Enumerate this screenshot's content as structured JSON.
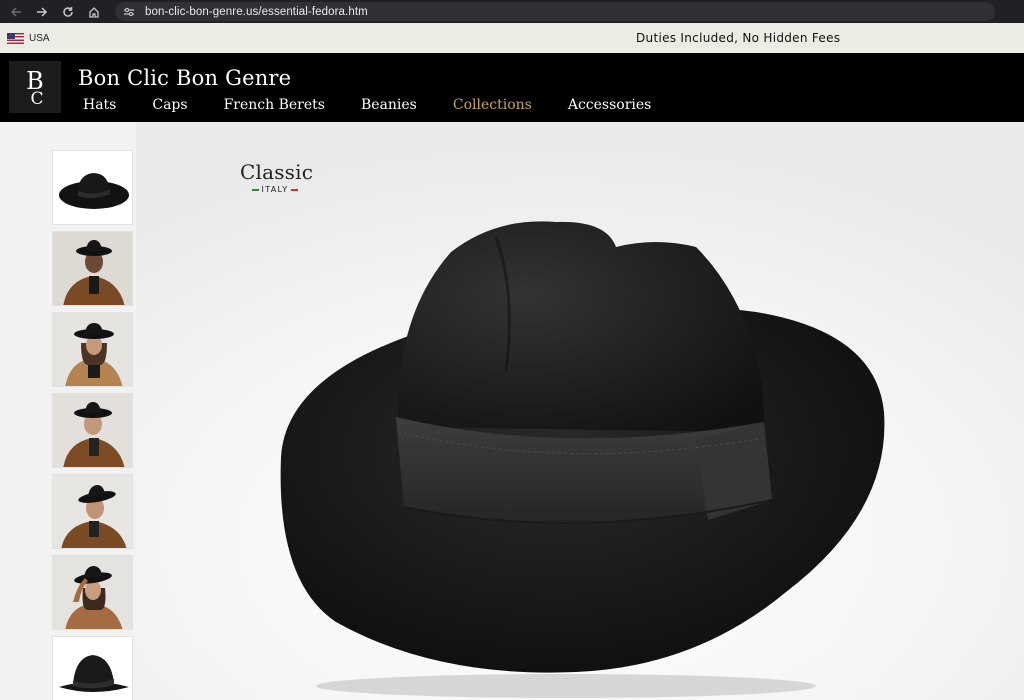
{
  "browser": {
    "url": "bon-clic-bon-genre.us/essential-fedora.htm"
  },
  "promo": {
    "locale": "USA",
    "message": "Duties Included, No Hidden Fees"
  },
  "header": {
    "brand": "Bon Clic Bon Genre",
    "nav": [
      {
        "label": "Hats"
      },
      {
        "label": "Caps"
      },
      {
        "label": "French Berets"
      },
      {
        "label": "Beanies"
      },
      {
        "label": "Collections",
        "active": true
      },
      {
        "label": "Accessories"
      }
    ]
  },
  "product": {
    "badge_title": "Classic",
    "badge_sub": "ITALY"
  },
  "colors": {
    "accent": "#c9a55c",
    "header_bg": "#000000",
    "promo_bg": "#ecebe4",
    "italy_green": "#2e8b3d",
    "italy_red": "#d32f2f"
  },
  "icons": {
    "back": "arrow-left-icon",
    "forward": "arrow-right-icon",
    "reload": "reload-icon",
    "home": "home-icon",
    "site_info": "tune-icon",
    "flag": "us-flag-icon"
  }
}
